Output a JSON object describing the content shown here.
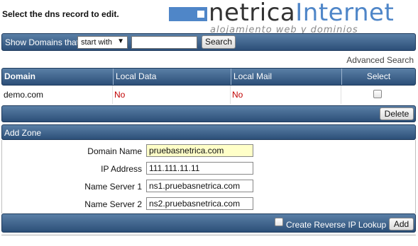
{
  "page": {
    "title": "Select the dns record to edit."
  },
  "logo": {
    "word1": "netrica",
    "word2": "Internet",
    "tagline": "alojamiento web y dominios"
  },
  "search": {
    "label": "Show Domains that",
    "match_select": "start with",
    "query": "",
    "button": "Search",
    "advanced_link": "Advanced Search"
  },
  "domains_table": {
    "columns": [
      "Domain",
      "Local Data",
      "Local Mail",
      "Select"
    ],
    "rows": [
      {
        "domain": "demo.com",
        "local_data": "No",
        "local_mail": "No",
        "selected": false
      }
    ],
    "delete_button": "Delete"
  },
  "add_zone": {
    "title": "Add Zone",
    "fields": [
      {
        "label": "Domain Name",
        "value": "pruebasnetrica.com"
      },
      {
        "label": "IP Address",
        "value": "111.111.11.11"
      },
      {
        "label": "Name Server 1",
        "value": "ns1.pruebasnetrica.com"
      },
      {
        "label": "Name Server 2",
        "value": "ns2.pruebasnetrica.com"
      }
    ],
    "reverse_lookup_label": "Create Reverse IP Lookup",
    "reverse_lookup_checked": false,
    "add_button": "Add"
  },
  "colors": {
    "bar": "#3d6290",
    "accent": "#4f86c8",
    "no_text": "#c00000",
    "highlight_input": "#ffffc8"
  }
}
